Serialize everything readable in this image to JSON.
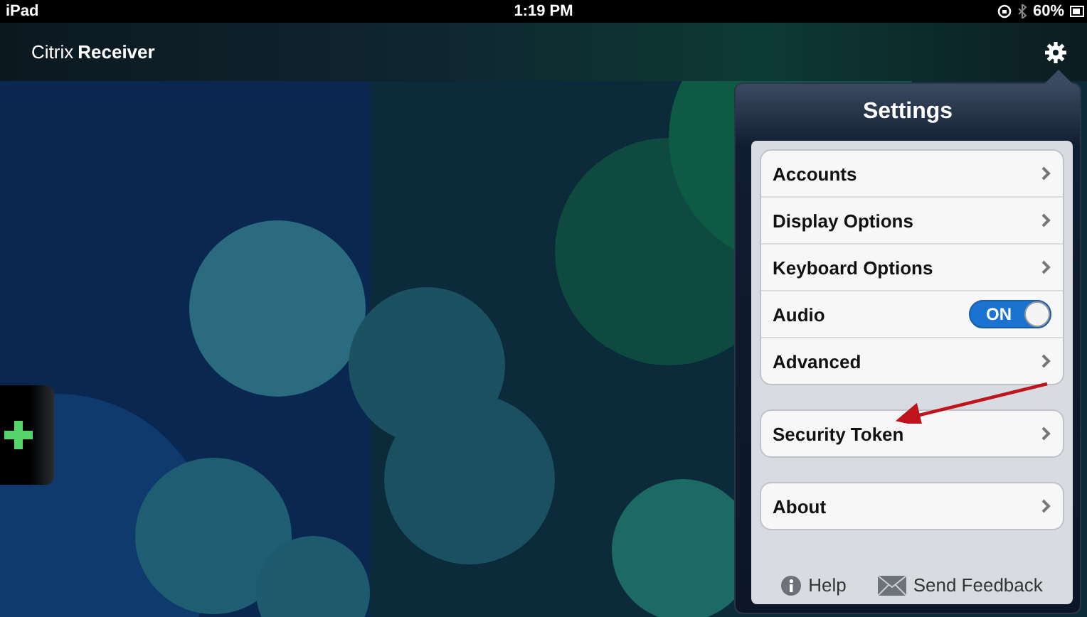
{
  "status_bar": {
    "device": "iPad",
    "time": "1:19 PM",
    "battery": "60%"
  },
  "header": {
    "brand_light": "Citrix",
    "brand_bold": "Receiver"
  },
  "settings": {
    "title": "Settings",
    "groups": [
      {
        "rows": [
          {
            "kind": "link",
            "label": "Accounts"
          },
          {
            "kind": "link",
            "label": "Display Options"
          },
          {
            "kind": "link",
            "label": "Keyboard Options"
          },
          {
            "kind": "toggle",
            "label": "Audio",
            "on": true,
            "toggle_text": "ON"
          },
          {
            "kind": "link",
            "label": "Advanced"
          }
        ]
      },
      {
        "rows": [
          {
            "kind": "link",
            "label": "Security Token"
          }
        ]
      },
      {
        "rows": [
          {
            "kind": "link",
            "label": "About"
          }
        ]
      }
    ],
    "footer": [
      {
        "kind": "info",
        "label": "Help"
      },
      {
        "kind": "mail",
        "label": "Send Feedback"
      }
    ]
  }
}
